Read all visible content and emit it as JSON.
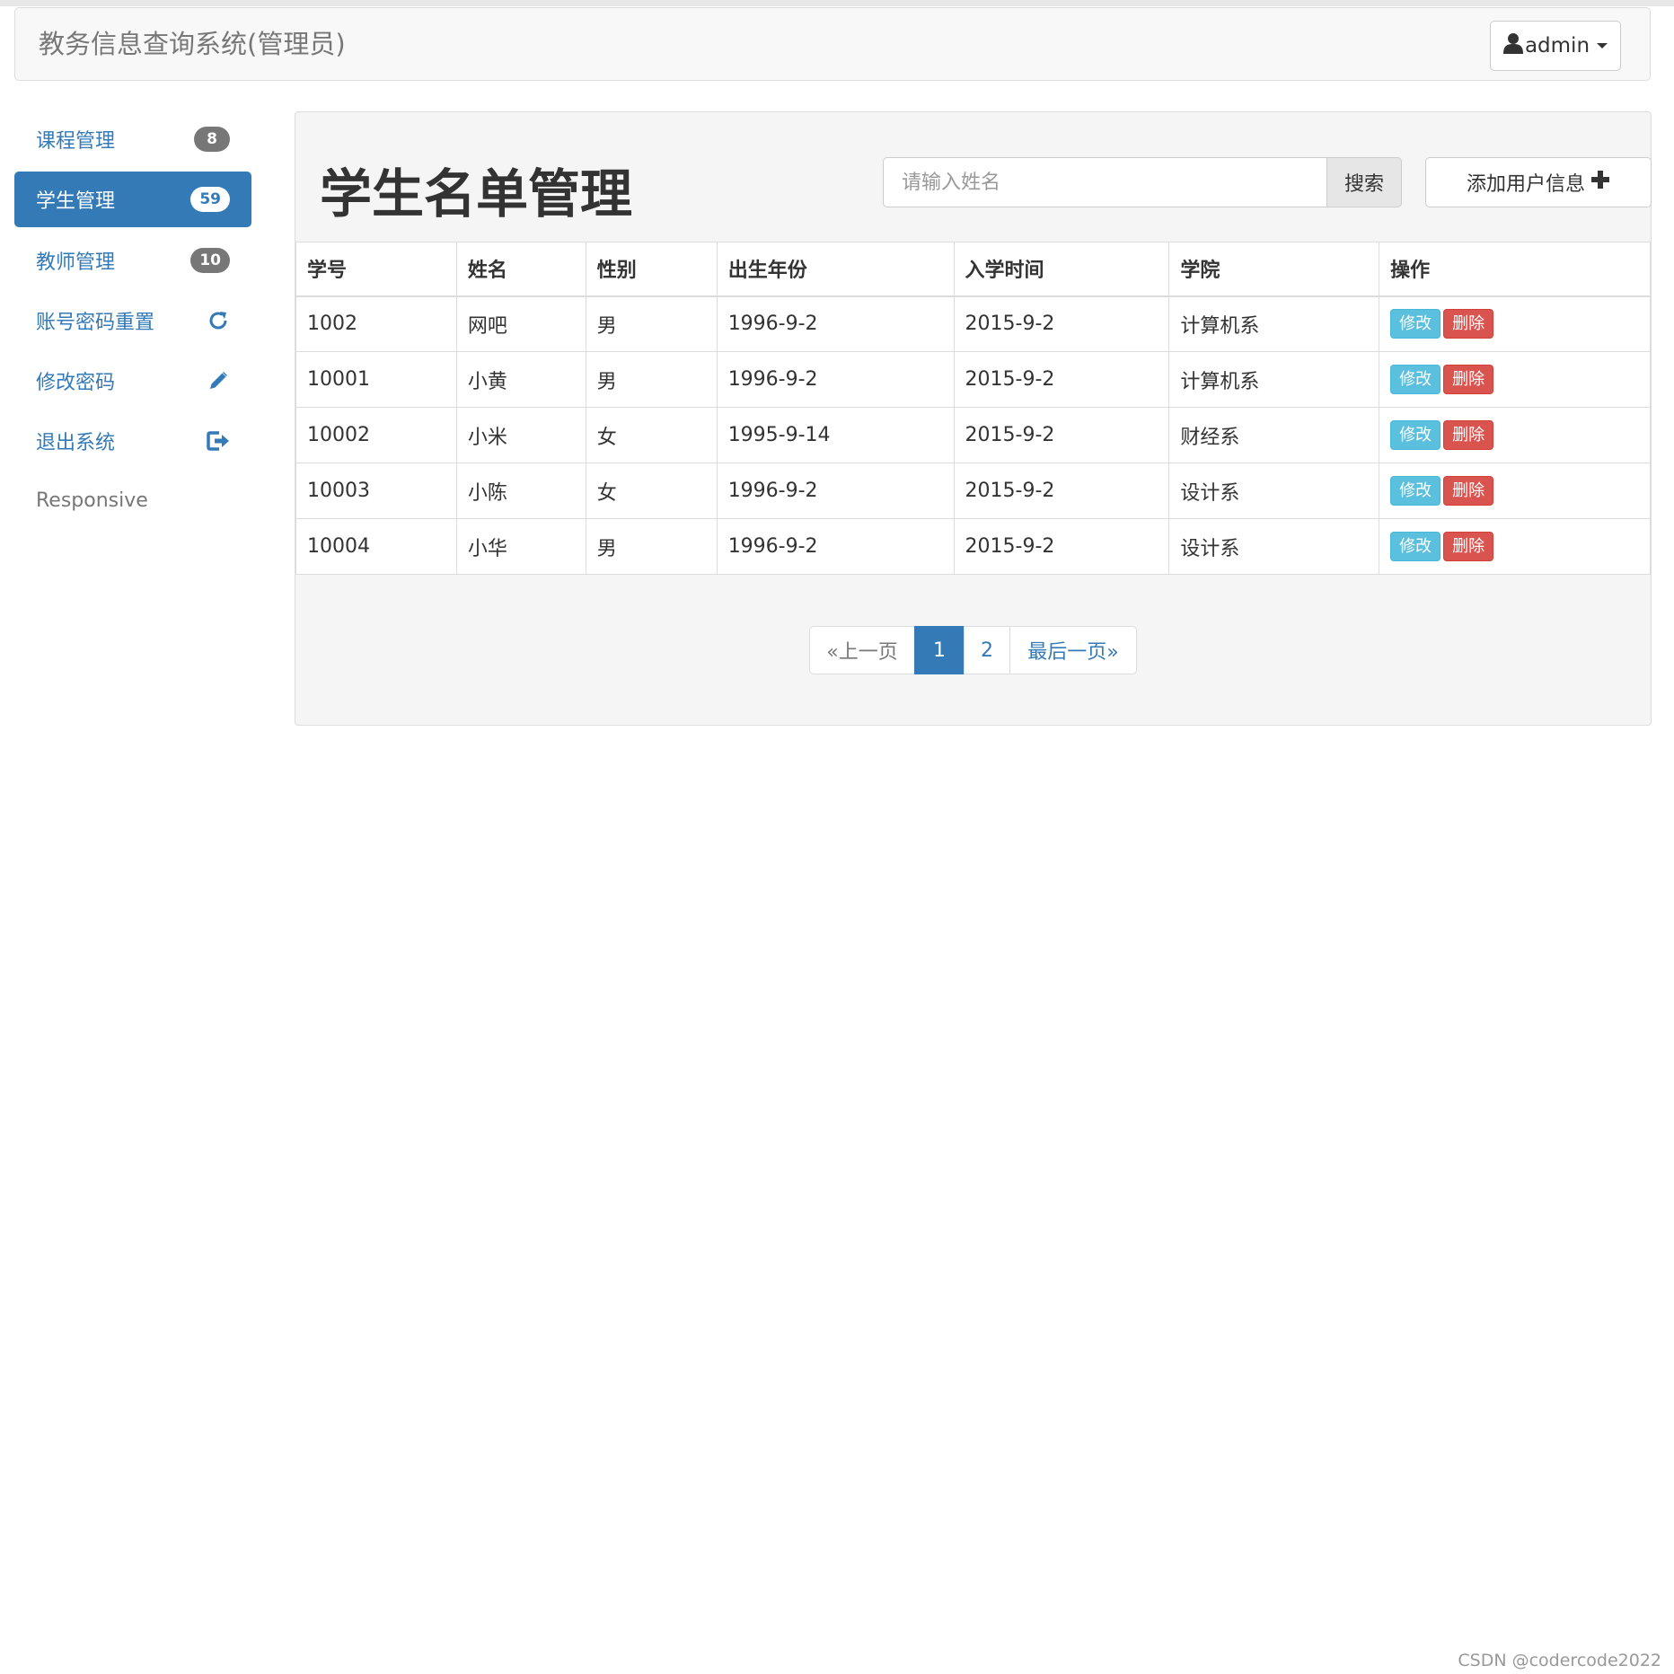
{
  "navbar": {
    "brand": "教务信息查询系统(管理员)",
    "user_label": "admin"
  },
  "sidebar": {
    "items": [
      {
        "label": "课程管理",
        "badge": "8"
      },
      {
        "label": "学生管理",
        "badge": "59"
      },
      {
        "label": "教师管理",
        "badge": "10"
      },
      {
        "label": "账号密码重置",
        "icon": "refresh-icon"
      },
      {
        "label": "修改密码",
        "icon": "pencil-icon"
      },
      {
        "label": "退出系统",
        "icon": "logout-icon"
      }
    ],
    "responsive_label": "Responsive"
  },
  "main": {
    "title": "学生名单管理",
    "search": {
      "placeholder": "请输入姓名",
      "value": "",
      "button_label": "搜索"
    },
    "add_button_label": "添加用户信息",
    "table": {
      "headers": [
        "学号",
        "姓名",
        "性别",
        "出生年份",
        "入学时间",
        "学院",
        "操作"
      ],
      "rows": [
        [
          "1002",
          "网吧",
          "男",
          "1996-9-2",
          "2015-9-2",
          "计算机系"
        ],
        [
          "10001",
          "小黄",
          "男",
          "1996-9-2",
          "2015-9-2",
          "计算机系"
        ],
        [
          "10002",
          "小米",
          "女",
          "1995-9-14",
          "2015-9-2",
          "财经系"
        ],
        [
          "10003",
          "小陈",
          "女",
          "1996-9-2",
          "2015-9-2",
          "设计系"
        ],
        [
          "10004",
          "小华",
          "男",
          "1996-9-2",
          "2015-9-2",
          "设计系"
        ]
      ],
      "edit_label": "修改",
      "delete_label": "删除"
    },
    "pagination": {
      "prev": "«上一页",
      "pages": [
        "1",
        "2"
      ],
      "current": "1",
      "last": "最后一页»"
    }
  },
  "watermark": "CSDN @codercode2022",
  "colors": {
    "primary": "#337ab7",
    "info": "#5bc0de",
    "danger": "#d9534f",
    "badge": "#777777"
  }
}
